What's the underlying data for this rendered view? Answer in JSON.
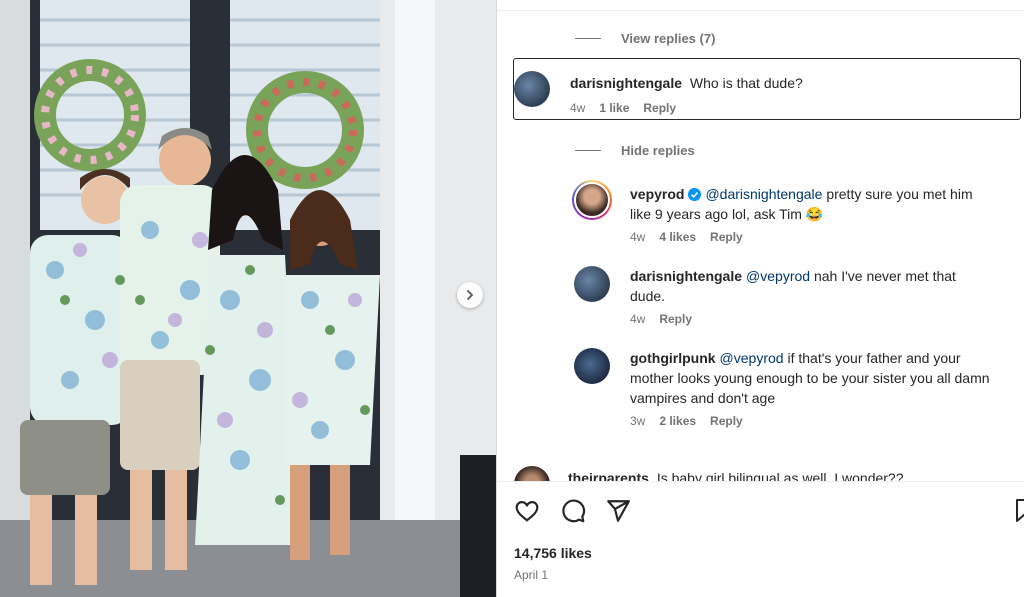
{
  "photo": {
    "alt": "family photo",
    "next_icon": "chevron-right-icon"
  },
  "comments": {
    "view_replies": "View replies (7)",
    "hide_replies": "Hide replies",
    "main": {
      "user": "darisnightengale",
      "text": "Who is that dude?",
      "time": "4w",
      "likes": "1 like",
      "reply": "Reply"
    },
    "replies": [
      {
        "user": "vepyrod",
        "verified": true,
        "mention": "@darisnightengale",
        "text": " pretty sure you met him like 9 years ago lol, ask Tim 😂",
        "time": "4w",
        "likes": "4 likes",
        "reply": "Reply"
      },
      {
        "user": "darisnightengale",
        "mention": "@vepyrod",
        "text": " nah I've never met that dude.",
        "time": "4w",
        "reply": "Reply"
      },
      {
        "user": "gothgirlpunk",
        "mention": "@vepyrod",
        "text": " if that's your father and your mother looks young enough to be your sister you all damn vampires and don't age",
        "time": "3w",
        "likes": "2 likes",
        "reply": "Reply"
      }
    ],
    "partial": {
      "user": "theirparents",
      "text": "Is baby girl bilingual as well, I wonder??"
    }
  },
  "actions": {
    "like_icon": "heart-icon",
    "comment_icon": "comment-icon",
    "share_icon": "share-icon",
    "save_icon": "bookmark-icon",
    "likes_count": "14,756 likes",
    "date": "April 1"
  }
}
